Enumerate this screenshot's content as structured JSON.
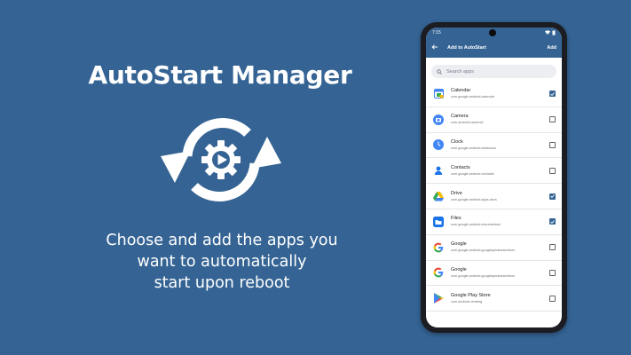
{
  "promo": {
    "title": "AutoStart Manager",
    "subtitle_lines": [
      "Choose and add the apps you",
      "want to automatically",
      "start upon reboot"
    ]
  },
  "colors": {
    "background": "#356494",
    "accent": "#356494",
    "white": "#ffffff"
  },
  "phone": {
    "status_time": "7:15",
    "app_bar": {
      "title": "Add to AutoStart",
      "action_label": "Add",
      "back_icon": "arrow-back-icon"
    },
    "search": {
      "placeholder": "Search apps"
    },
    "apps": [
      {
        "name": "Calendar",
        "package": "com.google.android.calendar",
        "checked": true,
        "icon": "calendar-icon"
      },
      {
        "name": "Camera",
        "package": "com.android.camera2",
        "checked": false,
        "icon": "camera-icon"
      },
      {
        "name": "Clock",
        "package": "com.google.android.deskclock",
        "checked": false,
        "icon": "clock-icon"
      },
      {
        "name": "Contacts",
        "package": "com.google.android.contacts",
        "checked": false,
        "icon": "contacts-icon"
      },
      {
        "name": "Drive",
        "package": "com.google.android.apps.docs",
        "checked": true,
        "icon": "drive-icon"
      },
      {
        "name": "Files",
        "package": "com.google.android.documentsui",
        "checked": true,
        "icon": "files-icon"
      },
      {
        "name": "Google",
        "package": "com.google.android.googlequicksearchbox",
        "checked": false,
        "icon": "google-icon"
      },
      {
        "name": "Google",
        "package": "com.google.android.googlequicksearchbox",
        "checked": false,
        "icon": "google-icon"
      },
      {
        "name": "Google Play Store",
        "package": "com.android.vending",
        "checked": false,
        "icon": "play-store-icon"
      }
    ]
  }
}
